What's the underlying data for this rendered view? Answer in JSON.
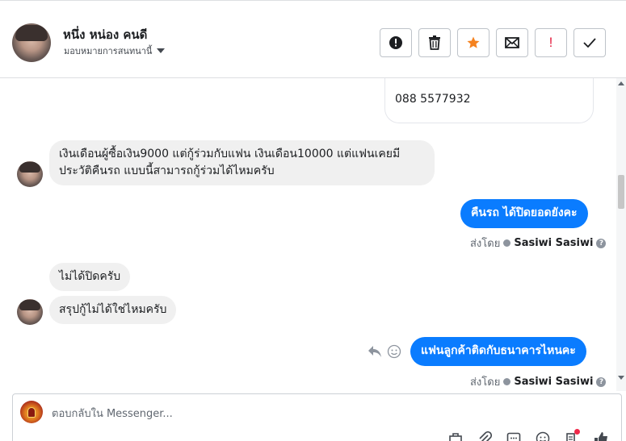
{
  "header": {
    "contact_name": "หนึ่ง หน่อง คนดี",
    "assign_label": "มอบหมายการสนทนานี้",
    "actions": [
      {
        "name": "report-button",
        "icon": "alert-circle-icon"
      },
      {
        "name": "delete-button",
        "icon": "trash-icon"
      },
      {
        "name": "star-button",
        "icon": "star-icon"
      },
      {
        "name": "mark-unread-button",
        "icon": "envelope-icon"
      },
      {
        "name": "spam-button",
        "icon": "exclamation-icon",
        "label": "!"
      },
      {
        "name": "done-button",
        "icon": "checkmark-icon"
      }
    ],
    "accent_star": "#f5821f",
    "accent_spam": "#e41e3f"
  },
  "messages": {
    "phone_card": "088 5577932",
    "incoming_1": "เงินเดือนผู้ซื้อเงิน9000 แต่กู้ร่วมกับแฟน เงินเดือน10000 แต่แฟนเคยมีประวัติคืนรถ แบบนี้สามารถกู้ร่วมได้ไหมครับ",
    "outgoing_1": "คืนรถ ได้ปิดยอดยังคะ",
    "sent_by_label": "ส่งโดย",
    "sent_by_name": "Sasiwi Sasiwi",
    "incoming_2": "ไม่ได้ปิดครับ",
    "incoming_3": "สรุปกู้ไม่ได้ใช่ไหมครับ",
    "outgoing_2": "แฟนลูกค้าติดกับธนาคารไหนคะ",
    "help_glyph": "?",
    "bubble_color": "#0a7cff"
  },
  "composer": {
    "placeholder": "ตอบกลับใน Messenger...",
    "tools": [
      "bag-icon",
      "paperclip-icon",
      "saved-reply-icon",
      "emoji-icon",
      "notes-icon",
      "thumbs-up-icon"
    ]
  }
}
